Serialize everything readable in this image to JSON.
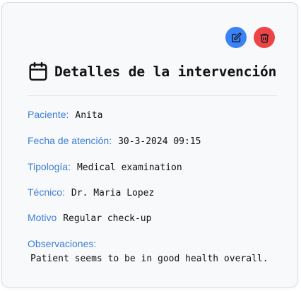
{
  "header": {
    "title": "Detalles de la intervención",
    "icon": "calendar-icon"
  },
  "actions": {
    "edit": {
      "icon": "edit-icon",
      "color": "#3b82f6"
    },
    "delete": {
      "icon": "trash-icon",
      "color": "#ef4444"
    }
  },
  "fields": {
    "paciente": {
      "label": "Paciente:",
      "value": "Anita"
    },
    "fecha": {
      "label": "Fecha de atención:",
      "value": "30-3-2024 09:15"
    },
    "tipologia": {
      "label": "Tipología:",
      "value": "Medical examination"
    },
    "tecnico": {
      "label": "Técnico:",
      "value": "Dr. Maria Lopez"
    },
    "motivo": {
      "label": "Motivo",
      "value": "Regular check-up"
    },
    "observaciones": {
      "label": "Observaciones:",
      "value": "Patient seems to be in good health overall."
    }
  },
  "colors": {
    "label": "#3d7ed8",
    "text": "#111111",
    "card_background": "#f8f9fb"
  }
}
